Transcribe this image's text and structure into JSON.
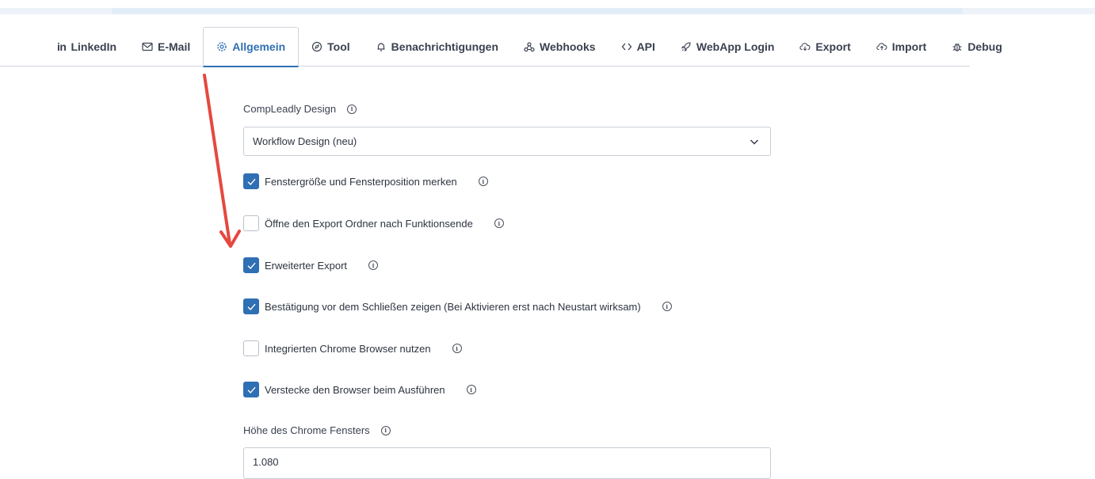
{
  "tabs": [
    {
      "label": "LinkedIn",
      "icon": "linkedin-icon"
    },
    {
      "label": "E-Mail",
      "icon": "mail-icon"
    },
    {
      "label": "Allgemein",
      "icon": "gear-icon",
      "active": true
    },
    {
      "label": "Tool",
      "icon": "compass-icon"
    },
    {
      "label": "Benachrichtigungen",
      "icon": "bell-icon"
    },
    {
      "label": "Webhooks",
      "icon": "webhook-icon"
    },
    {
      "label": "API",
      "icon": "code-icon"
    },
    {
      "label": "WebApp Login",
      "icon": "rocket-icon"
    },
    {
      "label": "Export",
      "icon": "cloud-download-icon"
    },
    {
      "label": "Import",
      "icon": "cloud-upload-icon"
    },
    {
      "label": "Debug",
      "icon": "bug-icon"
    }
  ],
  "tab_icon_text": {
    "linkedin": "in"
  },
  "design": {
    "label": "CompLeadly Design",
    "value": "Workflow Design (neu)"
  },
  "checkboxes": [
    {
      "label": "Fenstergröße und Fensterposition merken",
      "checked": true
    },
    {
      "label": "Öffne den Export Ordner nach Funktionsende",
      "checked": false
    },
    {
      "label": "Erweiterter Export",
      "checked": true
    },
    {
      "label": "Bestätigung vor dem Schließen zeigen (Bei Aktivieren erst nach Neustart wirksam)",
      "checked": true
    },
    {
      "label": "Integrierten Chrome Browser nutzen",
      "checked": false
    },
    {
      "label": "Verstecke den Browser beim Ausführen",
      "checked": true
    }
  ],
  "chrome_height": {
    "label": "Höhe des Chrome Fensters",
    "value": "1.080"
  },
  "info_glyph": "i",
  "colors": {
    "accent": "#2f6fb3",
    "annotation_arrow": "#e5483f"
  }
}
